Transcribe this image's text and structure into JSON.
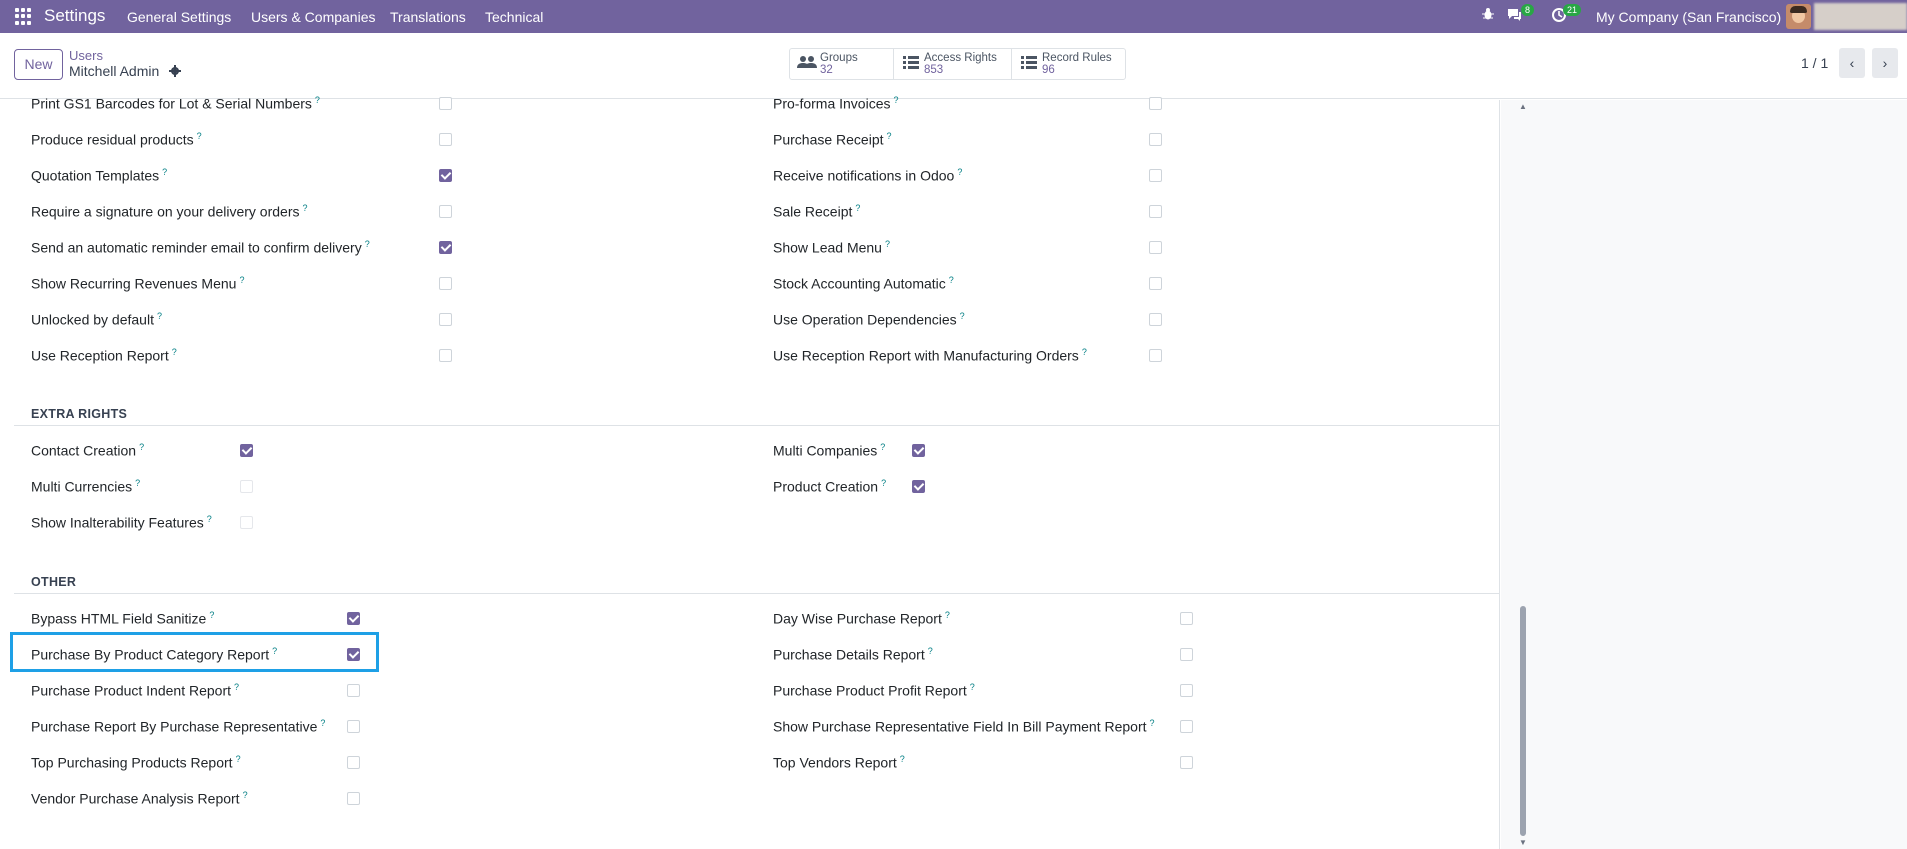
{
  "navbar": {
    "brand": "Settings",
    "menu": [
      "General Settings",
      "Users & Companies",
      "Translations",
      "Technical"
    ],
    "bug_icon": "bug-icon",
    "chat_badge": "8",
    "activity_badge": "21",
    "company": "My Company (San Francisco)"
  },
  "control": {
    "new_label": "New",
    "breadcrumb_parent": "Users",
    "breadcrumb_current": "Mitchell Admin",
    "stats": [
      {
        "label": "Groups",
        "count": "32",
        "icon": "users-icon"
      },
      {
        "label": "Access Rights",
        "count": "853",
        "icon": "list-icon"
      },
      {
        "label": "Record Rules",
        "count": "96",
        "icon": "list-icon"
      }
    ],
    "pager": "1 / 1"
  },
  "top_rows_left": [
    {
      "label": "Print GS1 Barcodes for Lot & Serial Numbers",
      "checked": false
    },
    {
      "label": "Produce residual products",
      "checked": false
    },
    {
      "label": "Quotation Templates",
      "checked": true
    },
    {
      "label": "Require a signature on your delivery orders",
      "checked": false
    },
    {
      "label": "Send an automatic reminder email to confirm delivery",
      "checked": true
    },
    {
      "label": "Show Recurring Revenues Menu",
      "checked": false
    },
    {
      "label": "Unlocked by default",
      "checked": false
    },
    {
      "label": "Use Reception Report",
      "checked": false
    }
  ],
  "top_rows_right": [
    {
      "label": "Pro-forma Invoices",
      "checked": false
    },
    {
      "label": "Purchase Receipt",
      "checked": false
    },
    {
      "label": "Receive notifications in Odoo",
      "checked": false
    },
    {
      "label": "Sale Receipt",
      "checked": false
    },
    {
      "label": "Show Lead Menu",
      "checked": false
    },
    {
      "label": "Stock Accounting Automatic",
      "checked": false
    },
    {
      "label": "Use Operation Dependencies",
      "checked": false
    },
    {
      "label": "Use Reception Report with Manufacturing Orders",
      "checked": false
    }
  ],
  "extra_rights": {
    "title": "EXTRA RIGHTS",
    "left": [
      {
        "label": "Contact Creation",
        "checked": true
      },
      {
        "label": "Multi Currencies",
        "checked": false
      },
      {
        "label": "Show Inalterability Features",
        "checked": false
      }
    ],
    "right": [
      {
        "label": "Multi Companies",
        "checked": true
      },
      {
        "label": "Product Creation",
        "checked": true
      }
    ]
  },
  "other": {
    "title": "OTHER",
    "left": [
      {
        "label": "Bypass HTML Field Sanitize",
        "checked": true
      },
      {
        "label": "Purchase By Product Category Report",
        "checked": true
      },
      {
        "label": "Purchase Product Indent Report",
        "checked": false
      },
      {
        "label": "Purchase Report By Purchase Representative",
        "checked": false
      },
      {
        "label": "Top Purchasing Products Report",
        "checked": false
      },
      {
        "label": "Vendor Purchase Analysis Report",
        "checked": false
      }
    ],
    "right": [
      {
        "label": "Day Wise Purchase Report",
        "checked": false
      },
      {
        "label": "Purchase Details Report",
        "checked": false
      },
      {
        "label": "Purchase Product Profit Report",
        "checked": false
      },
      {
        "label": "Show Purchase Representative Field In Bill Payment Report",
        "checked": false
      },
      {
        "label": "Top Vendors Report",
        "checked": false
      }
    ]
  },
  "help_marker": "?",
  "colors": {
    "brand": "#71639e",
    "highlight": "#1ea0e6",
    "help": "#017e84"
  }
}
